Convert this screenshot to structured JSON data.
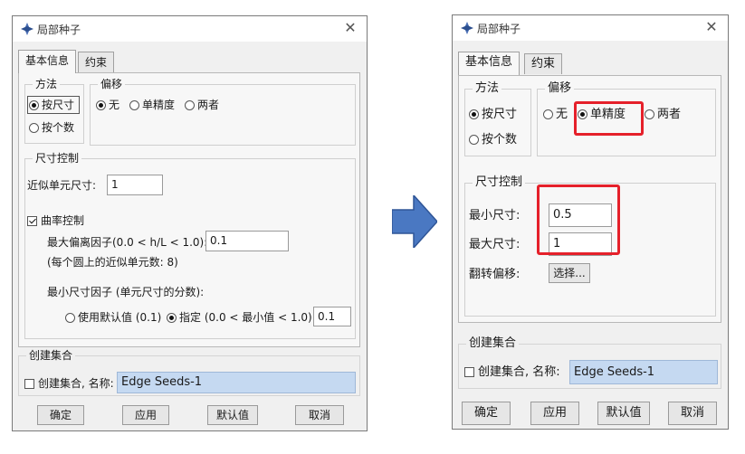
{
  "left_dialog": {
    "title": "局部种子",
    "tabs": [
      "基本信息",
      "约束"
    ],
    "method": {
      "title": "方法",
      "by_size": "按尺寸",
      "by_number": "按个数"
    },
    "bias": {
      "title": "偏移",
      "none": "无",
      "single": "单精度",
      "both": "两者"
    },
    "size_control": {
      "title": "尺寸控制",
      "approx_label": "近似单元尺寸:",
      "approx_value": "1",
      "curvature_label": "曲率控制",
      "max_dev_label": "最大偏离因子(0.0 < h/L < 1.0):",
      "max_dev_value": "0.1",
      "elements_note": "(每个圆上的近似单元数: 8)",
      "min_size_label": "最小尺寸因子 (单元尺寸的分数):",
      "use_default": "使用默认值 (0.1)",
      "specify": "指定 (0.0 < 最小值 < 1.0)",
      "specify_value": "0.1"
    },
    "create_set": {
      "title": "创建集合",
      "checkbox_label": "创建集合, 名称:",
      "name_value": "Edge Seeds-1"
    },
    "buttons": {
      "ok": "确定",
      "apply": "应用",
      "defaults": "默认值",
      "cancel": "取消"
    }
  },
  "right_dialog": {
    "title": "局部种子",
    "tabs": [
      "基本信息",
      "约束"
    ],
    "method": {
      "title": "方法",
      "by_size": "按尺寸",
      "by_number": "按个数"
    },
    "bias": {
      "title": "偏移",
      "none": "无",
      "single": "单精度",
      "both": "两者"
    },
    "size_control": {
      "title": "尺寸控制",
      "min_label": "最小尺寸:",
      "min_value": "0.5",
      "max_label": "最大尺寸:",
      "max_value": "1",
      "flip_label": "翻转偏移:",
      "select_button": "选择..."
    },
    "create_set": {
      "title": "创建集合",
      "checkbox_label": "创建集合, 名称:",
      "name_value": "Edge Seeds-1"
    },
    "buttons": {
      "ok": "确定",
      "apply": "应用",
      "defaults": "默认值",
      "cancel": "取消"
    }
  },
  "icons": {
    "title": "seed-icon",
    "close": "close-icon",
    "arrow": "right-arrow-icon"
  },
  "colors": {
    "highlight": "#e5202a",
    "arrow": "#4a78c2",
    "name_field": "#c5d9f1"
  }
}
